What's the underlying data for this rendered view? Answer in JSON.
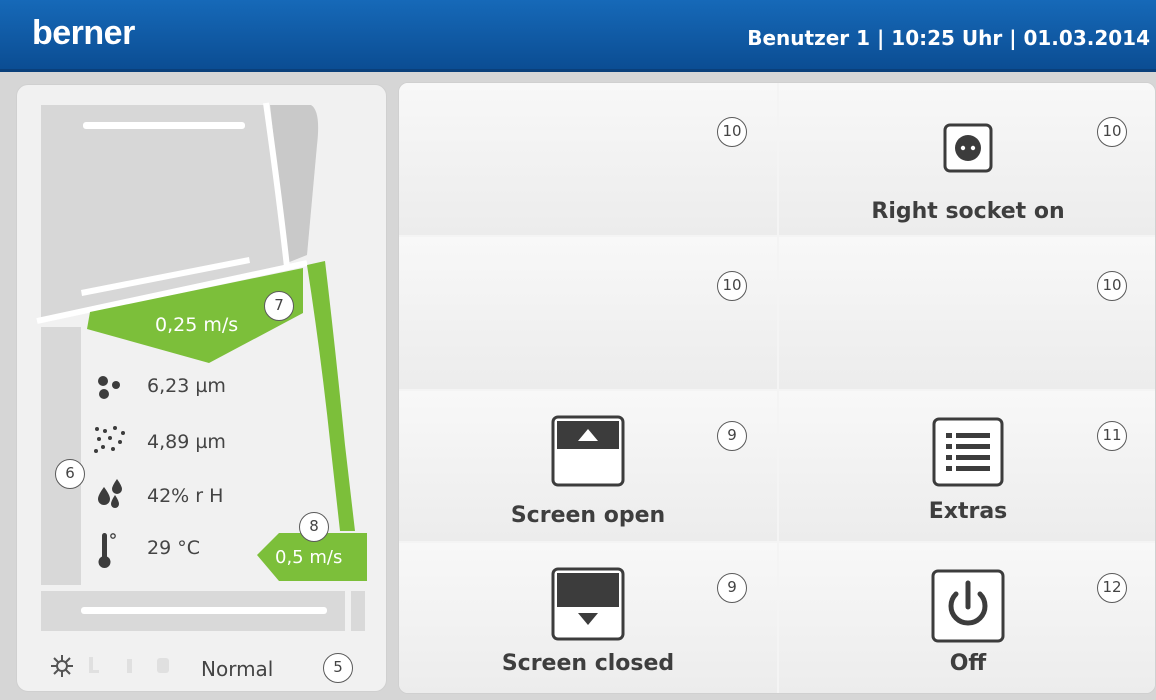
{
  "header": {
    "logo": "berner",
    "info": "Benutzer 1 | 10:25 Uhr | 01.03.2014"
  },
  "left": {
    "airflow_top": "0,25 m/s",
    "airflow_top_marker": "7",
    "airflow_bottom": "0,5 m/s",
    "airflow_bottom_marker": "8",
    "readings_marker": "6",
    "readings": [
      {
        "icon": "large-particles-icon",
        "value": "6,23 µm"
      },
      {
        "icon": "small-particles-icon",
        "value": "4,89 µm"
      },
      {
        "icon": "humidity-icon",
        "value": "42% r H"
      },
      {
        "icon": "thermometer-icon",
        "value": "29 °C"
      }
    ],
    "mode": "Normal",
    "mode_marker": "5",
    "colors": {
      "airflow_green": "#7cbf3a"
    }
  },
  "tiles": [
    {
      "label": "",
      "marker": "10",
      "icon": ""
    },
    {
      "label": "Right socket on",
      "marker": "10",
      "icon": "socket-icon"
    },
    {
      "label": "",
      "marker": "10",
      "icon": ""
    },
    {
      "label": "",
      "marker": "10",
      "icon": ""
    },
    {
      "label": "Screen open",
      "marker": "9",
      "icon": "screen-up-icon"
    },
    {
      "label": "Extras",
      "marker": "11",
      "icon": "list-icon"
    },
    {
      "label": "Screen closed",
      "marker": "9",
      "icon": "screen-down-icon"
    },
    {
      "label": "Off",
      "marker": "12",
      "icon": "power-icon"
    }
  ]
}
